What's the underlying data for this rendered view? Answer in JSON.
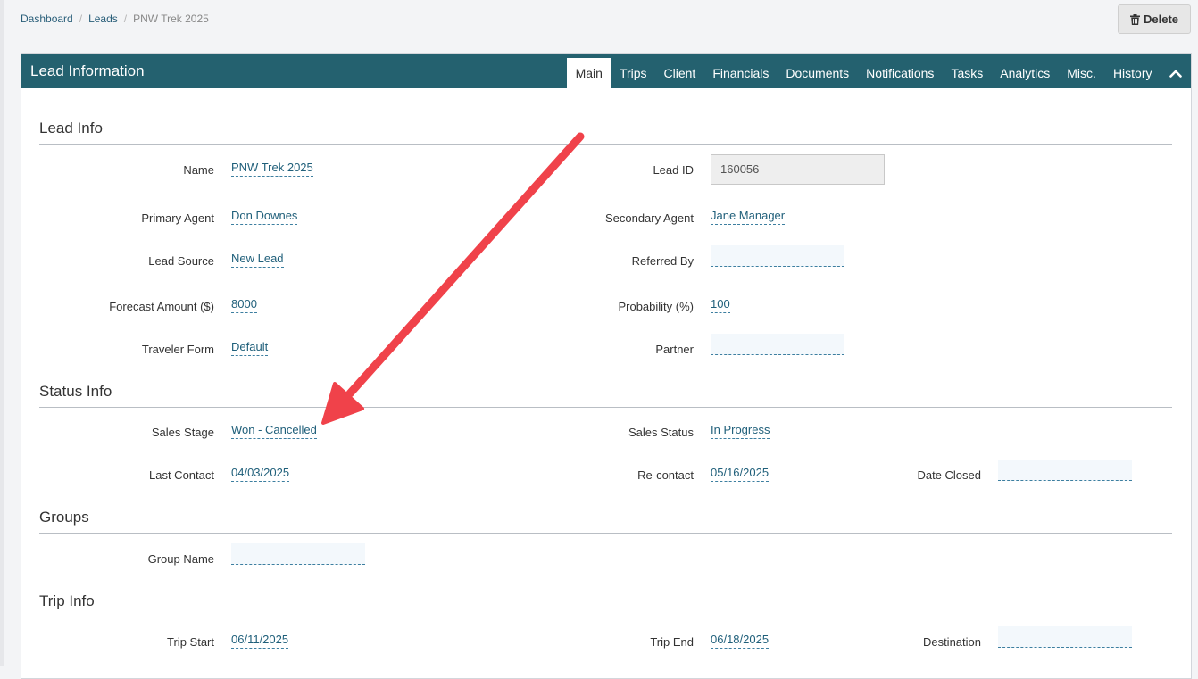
{
  "breadcrumb": [
    "Dashboard",
    "Leads",
    "PNW Trek 2025"
  ],
  "delete_label": "Delete",
  "panel_title": "Lead Information",
  "tabs": [
    "Main",
    "Trips",
    "Client",
    "Financials",
    "Documents",
    "Notifications",
    "Tasks",
    "Analytics",
    "Misc.",
    "History"
  ],
  "active_tab": "Main",
  "sections": {
    "lead_info": "Lead Info",
    "status_info": "Status Info",
    "groups": "Groups",
    "trip_info": "Trip Info"
  },
  "fields": {
    "name": {
      "label": "Name",
      "value": "PNW Trek 2025"
    },
    "lead_id": {
      "label": "Lead ID",
      "value": "160056"
    },
    "primary_agent": {
      "label": "Primary Agent",
      "value": "Don Downes"
    },
    "secondary_agent": {
      "label": "Secondary Agent",
      "value": "Jane Manager"
    },
    "lead_source": {
      "label": "Lead Source",
      "value": "New Lead"
    },
    "referred_by": {
      "label": "Referred By",
      "value": ""
    },
    "forecast_amount": {
      "label": "Forecast Amount ($)",
      "value": "8000"
    },
    "probability": {
      "label": "Probability (%)",
      "value": "100"
    },
    "traveler_form": {
      "label": "Traveler Form",
      "value": "Default"
    },
    "partner": {
      "label": "Partner",
      "value": ""
    },
    "sales_stage": {
      "label": "Sales Stage",
      "value": "Won - Cancelled"
    },
    "sales_status": {
      "label": "Sales Status",
      "value": "In Progress"
    },
    "last_contact": {
      "label": "Last Contact",
      "value": "04/03/2025"
    },
    "re_contact": {
      "label": "Re-contact",
      "value": "05/16/2025"
    },
    "date_closed": {
      "label": "Date Closed",
      "value": ""
    },
    "group_name": {
      "label": "Group Name",
      "value": ""
    },
    "trip_start": {
      "label": "Trip Start",
      "value": "06/11/2025"
    },
    "trip_end": {
      "label": "Trip End",
      "value": "06/18/2025"
    },
    "destination": {
      "label": "Destination",
      "value": ""
    }
  },
  "colors": {
    "header": "#24616f",
    "link": "#1f5f7a",
    "arrow": "#f0424a"
  },
  "icons": {
    "delete": "trash-icon",
    "collapse": "chevron-up-icon",
    "annotation": "annotation-arrow"
  }
}
